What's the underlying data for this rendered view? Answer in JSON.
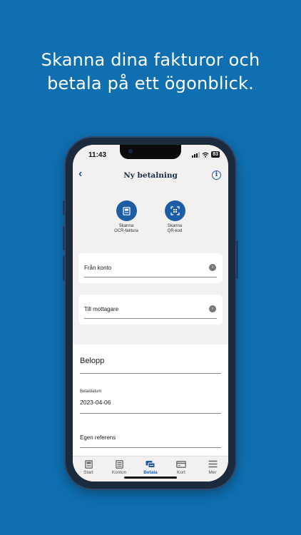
{
  "headline": {
    "line1": "Skanna dina fakturor och",
    "line2": "betala på ett ögonblick."
  },
  "statusbar": {
    "time": "11:43",
    "battery": "83"
  },
  "header": {
    "back_icon": "chevron-left-icon",
    "title": "Ny betalning",
    "info_icon": "info-circle-icon"
  },
  "scan": [
    {
      "line1": "Skanna",
      "line2": "OCR-faktura",
      "icon": "invoice-icon"
    },
    {
      "line1": "Skanna",
      "line2": "QR-kod",
      "icon": "qr-scan-icon"
    }
  ],
  "selectors": [
    {
      "label": "Från konto"
    },
    {
      "label": "Till mottagare"
    }
  ],
  "form": {
    "amount_label": "Belopp",
    "date_label": "Betaldatum",
    "date_value": "2023-04-06",
    "reference_label": "Egen referens"
  },
  "tabs": [
    {
      "label": "Start",
      "icon": "start-icon"
    },
    {
      "label": "Konton",
      "icon": "accounts-icon"
    },
    {
      "label": "Betala",
      "icon": "pay-icon",
      "active": true
    },
    {
      "label": "Kort",
      "icon": "card-icon"
    },
    {
      "label": "Mer",
      "icon": "menu-icon"
    }
  ],
  "colors": {
    "background": "#0f6fb0",
    "accent": "#1d5da6",
    "surface": "#f3f1ef"
  }
}
